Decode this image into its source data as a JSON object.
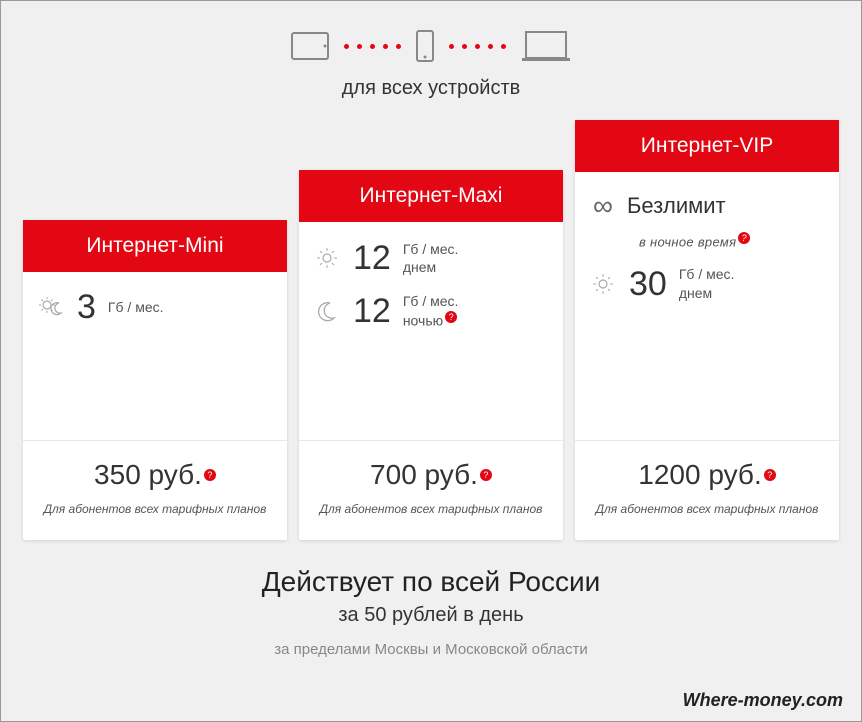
{
  "header": {
    "caption": "для всех устройств"
  },
  "plans": {
    "mini": {
      "title": "Интернет-Mini",
      "anytime": {
        "value": "3",
        "unit": "Гб / мес."
      },
      "price": "350 руб.",
      "note": "Для абонентов всех тарифных планов"
    },
    "maxi": {
      "title": "Интернет-Maxi",
      "day": {
        "value": "12",
        "unit_top": "Гб / мес.",
        "unit_bottom": "днем"
      },
      "night": {
        "value": "12",
        "unit_top": "Гб / мес.",
        "unit_bottom": "ночью"
      },
      "price": "700 руб.",
      "note": "Для абонентов всех тарифных планов"
    },
    "vip": {
      "title": "Интернет-VIP",
      "unlimited_label": "Безлимит",
      "unlimited_note": "в ночное время",
      "day": {
        "value": "30",
        "unit_top": "Гб / мес.",
        "unit_bottom": "днем"
      },
      "price": "1200 руб.",
      "note": "Для абонентов всех тарифных планов"
    }
  },
  "bottom": {
    "title": "Действует по всей России",
    "sub1": "за 50 рублей в день",
    "sub2": "за пределами Москвы и Московской области"
  },
  "watermark": "Where-money.com",
  "help_char": "?"
}
